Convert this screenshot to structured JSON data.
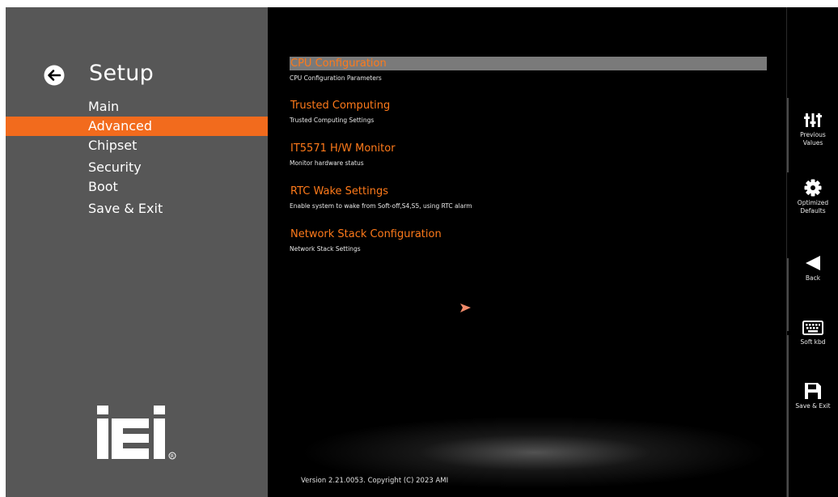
{
  "sidebar": {
    "title": "Setup",
    "back_icon": "arrow-left-icon",
    "items": [
      {
        "label": "Main"
      },
      {
        "label": "Advanced"
      },
      {
        "label": "Chipset"
      },
      {
        "label": "Security"
      },
      {
        "label": "Boot"
      },
      {
        "label": "Save & Exit"
      }
    ],
    "active_index": 1,
    "logo_icon": "iei-logo",
    "accent_color": "#f26b1d"
  },
  "main": {
    "entries": [
      {
        "title": "CPU Configuration",
        "description": "CPU Configuration Parameters"
      },
      {
        "title": "Trusted Computing",
        "description": "Trusted Computing Settings"
      },
      {
        "title": "IT5571 H/W Monitor",
        "description": "Monitor hardware status"
      },
      {
        "title": "RTC Wake Settings",
        "description": "Enable system to wake from Soft-off,S4,S5, using RTC alarm"
      },
      {
        "title": "Network Stack Configuration",
        "description": "Network Stack Settings"
      }
    ],
    "selected_index": 0,
    "version": "Version 2.21.0053. Copyright (C) 2023 AMI"
  },
  "toolbar": {
    "buttons": [
      {
        "label_line1": "Previous",
        "label_line2": "Values",
        "icon": "sliders-icon"
      },
      {
        "label_line1": "Optimized",
        "label_line2": "Defaults",
        "icon": "gear-icon"
      },
      {
        "label_line1": "Back",
        "label_line2": "",
        "icon": "triangle-left-icon"
      },
      {
        "label_line1": "Soft kbd",
        "label_line2": "",
        "icon": "keyboard-icon"
      },
      {
        "label_line1": "Save & Exit",
        "label_line2": "",
        "icon": "floppy-disk-icon"
      }
    ]
  }
}
